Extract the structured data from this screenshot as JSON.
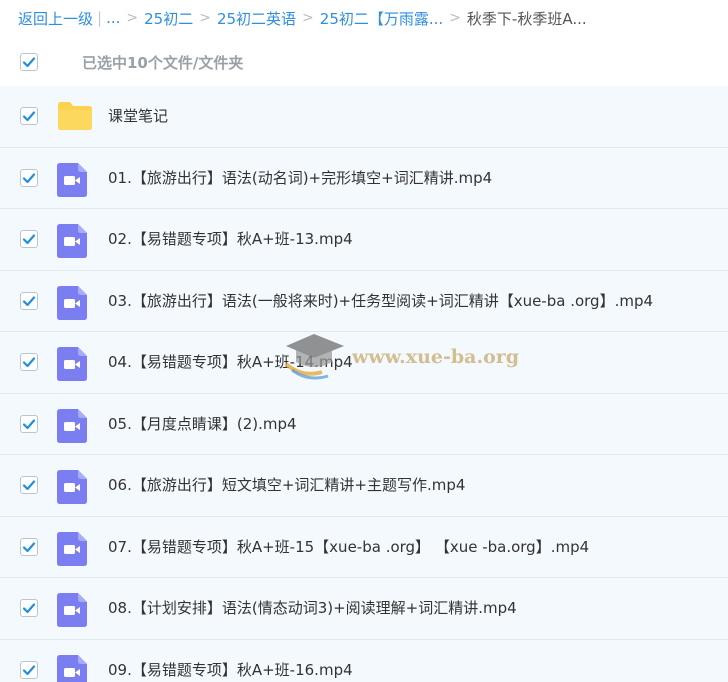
{
  "breadcrumb": {
    "back_label": "返回上一级",
    "ellipsis": "...",
    "items": [
      "25初二",
      "25初二英语",
      "25初二【万雨露..."
    ],
    "current": "秋季下-秋季班A..."
  },
  "selection": {
    "label": "已选中10个文件/文件夹",
    "all_checked": true
  },
  "files": [
    {
      "type": "folder",
      "name": "课堂笔记",
      "checked": true
    },
    {
      "type": "video",
      "name": "01.【旅游出行】语法(动名词)+完形填空+词汇精讲.mp4",
      "checked": true
    },
    {
      "type": "video",
      "name": "02.【易错题专项】秋A+班-13.mp4",
      "checked": true
    },
    {
      "type": "video",
      "name": "03.【旅游出行】语法(一般将来时)+任务型阅读+词汇精讲【xue-ba .org】.mp4",
      "checked": true
    },
    {
      "type": "video",
      "name": "04.【易错题专项】秋A+班-14.mp4",
      "checked": true
    },
    {
      "type": "video",
      "name": "05.【月度点睛课】(2).mp4",
      "checked": true
    },
    {
      "type": "video",
      "name": "06.【旅游出行】短文填空+词汇精讲+主题写作.mp4",
      "checked": true
    },
    {
      "type": "video",
      "name": "07.【易错题专项】秋A+班-15【xue-ba .org】 【xue -ba.org】.mp4",
      "checked": true
    },
    {
      "type": "video",
      "name": "08.【计划安排】语法(情态动词3)+阅读理解+词汇精讲.mp4",
      "checked": true
    },
    {
      "type": "video",
      "name": "09.【易错题专项】秋A+班-16.mp4",
      "checked": true
    }
  ],
  "watermark": {
    "text": "www.xue-ba.org"
  },
  "colors": {
    "accent": "#2e8ee0",
    "check": "#1f8fe0",
    "folder": "#fcd24f",
    "video": "#7b7ef0",
    "row_bg": "#f3f9fd"
  }
}
